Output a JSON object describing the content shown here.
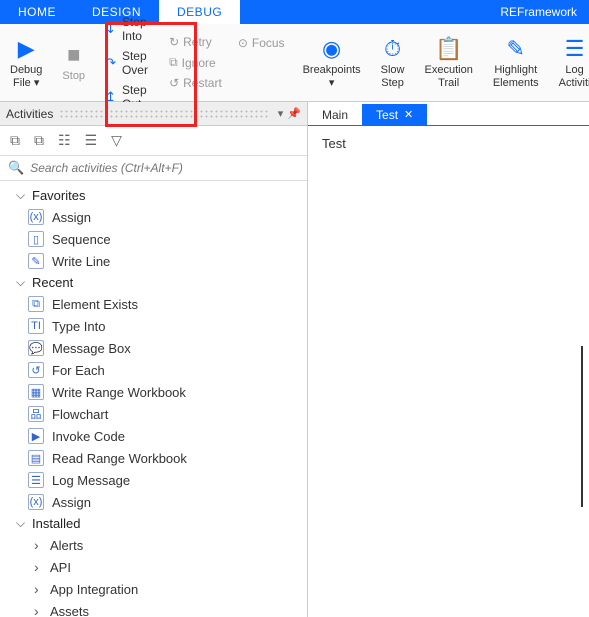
{
  "ribbon": {
    "tabs": [
      "HOME",
      "DESIGN",
      "DEBUG"
    ],
    "active": 2,
    "title": "REFramework"
  },
  "debug": {
    "debug_file": "Debug\nFile",
    "stop": "Stop",
    "step_into": "Step Into",
    "step_over": "Step Over",
    "step_out": "Step Out",
    "retry": "Retry",
    "focus": "Focus",
    "ignore": "Ignore",
    "restart": "Restart",
    "breakpoints": "Breakpoints",
    "slow_step": "Slow\nStep",
    "execution_trail": "Execution\nTrail",
    "highlight_elements": "Highlight\nElements",
    "log_activities": "Log\nActiviti"
  },
  "activities": {
    "title": "Activities",
    "search_placeholder": "Search activities (Ctrl+Alt+F)",
    "groups": {
      "favorites": {
        "label": "Favorites",
        "items": [
          "Assign",
          "Sequence",
          "Write Line"
        ]
      },
      "recent": {
        "label": "Recent",
        "items": [
          "Element Exists",
          "Type Into",
          "Message Box",
          "For Each",
          "Write Range Workbook",
          "Flowchart",
          "Invoke Code",
          "Read Range Workbook",
          "Log Message",
          "Assign"
        ]
      },
      "installed": {
        "label": "Installed",
        "subs": [
          "Alerts",
          "API",
          "App Integration",
          "Assets"
        ]
      }
    }
  },
  "docs": {
    "tabs": [
      {
        "label": "Main",
        "active": false
      },
      {
        "label": "Test",
        "active": true
      }
    ],
    "content": "Test"
  },
  "icons": {
    "fav": [
      "Assign",
      "Sequence",
      "Write Line"
    ],
    "recent_glyphs": [
      "⧉",
      "TI",
      "💬",
      "↺",
      "▦",
      "品",
      "▶",
      "▤",
      "☰",
      "(x)"
    ]
  }
}
